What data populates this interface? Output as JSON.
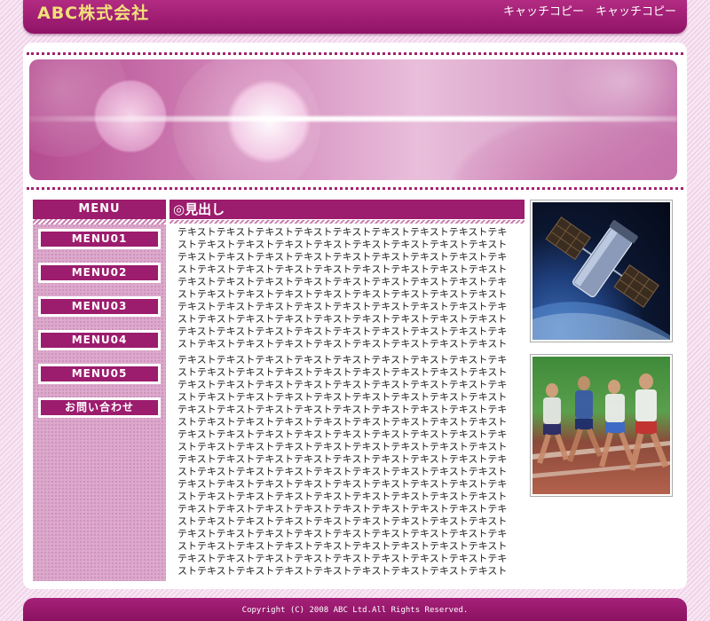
{
  "header": {
    "company_name": "ABC株式会社",
    "catch_copy": "キャッチコピー　キャッチコピー"
  },
  "sidebar": {
    "title": "MENU",
    "items": [
      {
        "label": "MENU01"
      },
      {
        "label": "MENU02"
      },
      {
        "label": "MENU03"
      },
      {
        "label": "MENU04"
      },
      {
        "label": "MENU05"
      },
      {
        "label": "お問い合わせ"
      }
    ]
  },
  "main": {
    "heading": "◎見出し",
    "paragraph1": "テキストテキストテキストテキストテキストテキストテキストテキストテキストテキストテキストテキストテキストテキストテキストテキストテキストテキストテキストテキストテキストテキストテキストテキストテキストテキストテキストテキストテキストテキストテキストテキストテキストテキストテキストテキストテキストテキストテキストテキストテキストテキストテキストテキストテキストテキストテキストテキストテキストテキストテキストテキストテキストテキストテキストテキストテキストテキストテキストテキストテキストテキストテキストテキストテキストテキストテキストテキストテキストテキストテキストテキストテキストテキストテキストテキストテキストテキストテキストテキストテキストテキストテキストテキストテキストテキストテキストテキストテキストテキスト",
    "paragraph2": "テキストテキストテキストテキストテキストテキストテキストテキストテキストテキストテキストテキストテキストテキストテキストテキストテキストテキストテキストテキストテキストテキストテキストテキストテキストテキストテキストテキストテキストテキストテキストテキストテキストテキストテキストテキストテキストテキストテキストテキストテキストテキストテキストテキストテキストテキストテキストテキストテキストテキストテキストテキストテキストテキストテキストテキストテキストテキストテキストテキストテキストテキストテキストテキストテキストテキストテキストテキストテキストテキストテキストテキストテキストテキストテキストテキストテキストテキストテキストテキストテキストテキストテキストテキストテキストテキストテキストテキストテキストテキストテキストテキストテキストテキストテキストテキストテキストテキストテキストテキストテキストテキストテキストテキストテキストテキストテキストテキストテキストテキストテキストテキストテキストテキストテキストテキストテキストテキストテキストテキストテキストテキストテキストテキストテキストテキストテキストテキストテキストテキストテキストテキストテキストテキストテキストテキストテキストテキストテキストテキストテキストテキストテキストテキストテキストテキストテキストテキストテキストテキストテキストテキストテキストテキストテキストテキストテキストテキストテキストテキストテキストテキスト"
  },
  "footer": {
    "copyright": "Copyright (C) 2008 ABC Ltd.All Rights Reserved."
  },
  "colors": {
    "brand": "#9c1c6d",
    "logo": "#f2e07a",
    "sidebar_bg": "#dca9cc"
  }
}
